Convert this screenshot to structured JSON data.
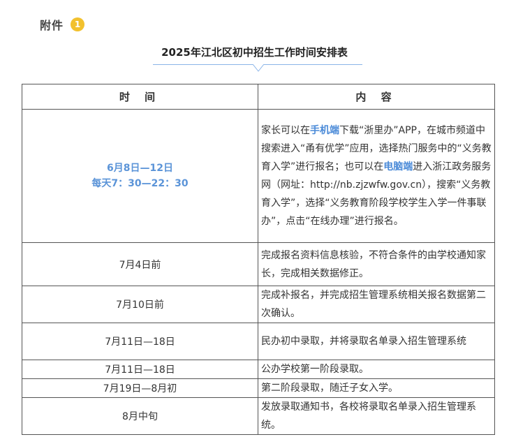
{
  "attachment": {
    "label": "附件",
    "badge": "1"
  },
  "title": "2025年江北区初中招生工作时间安排表",
  "table": {
    "headers": {
      "time": "时 间",
      "content": "内 容"
    },
    "row1": {
      "time_line1": "6月8日—12日",
      "time_line2": "每天7：30—22：30",
      "c_a": "家长可以在",
      "c_b": "手机端",
      "c_c": "下载“浙里办”APP，在城市频道中搜索进入“甬有优学”应用，选择热门服务中的“义务教育入学”进行报名；也可以在",
      "c_d": "电脑端",
      "c_e": "进入浙江政务服务网（网址：http://nb.zjzwfw.gov.cn），搜索“义务教育入学”，选择“义务教育阶段学校学生入学一件事联办”，点击“在线办理”进行报名。"
    },
    "rows": [
      {
        "time": "7月4日前",
        "content": "完成报名资料信息核验，不符合条件的由学校通知家长，完成相关数据修正。"
      },
      {
        "time": "7月10日前",
        "content": "完成补报名，并完成招生管理系统相关报名数据第二次确认。"
      },
      {
        "time": "7月11日—18日",
        "content": "民办初中录取，并将录取名单录入招生管理系统"
      },
      {
        "time": "7月11日—18日",
        "content": "公办学校第一阶段录取。"
      },
      {
        "time": "7月19日—8月初",
        "content": "第二阶段录取，随迁子女入学。"
      },
      {
        "time": "8月中旬",
        "content": "发放录取通知书，各校将录取名单录入招生管理系统。"
      }
    ]
  },
  "colors": {
    "accent": "#5b94d8",
    "badge": "#f2c12e",
    "title_line": "#8ab4e8"
  }
}
